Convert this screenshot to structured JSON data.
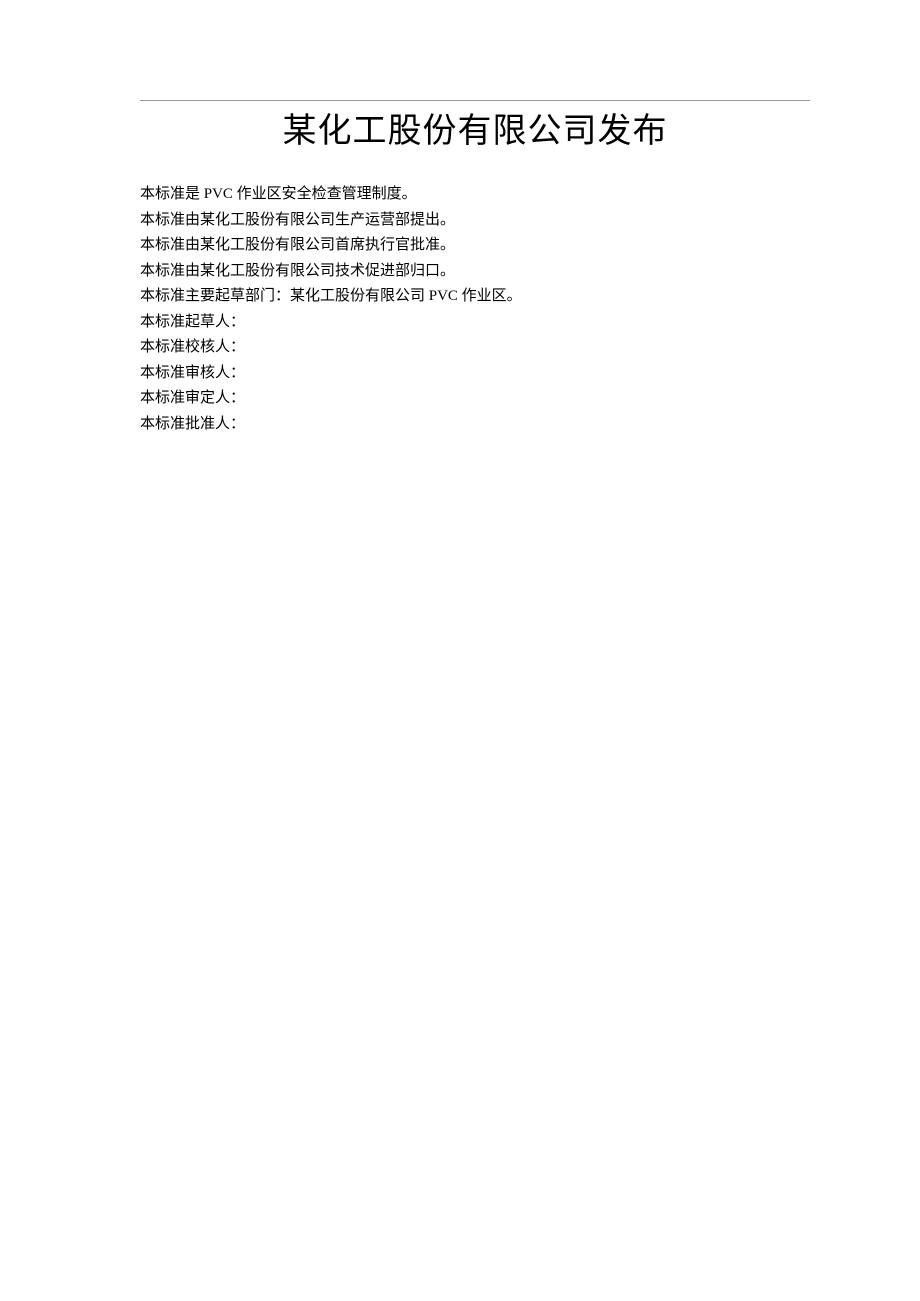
{
  "title": "某化工股份有限公司发布",
  "lines": {
    "l1": "本标准是 PVC 作业区安全检查管理制度。",
    "l2": "本标准由某化工股份有限公司生产运营部提出。",
    "l3": "本标准由某化工股份有限公司首席执行官批准。",
    "l4": "本标准由某化工股份有限公司技术促进部归口。",
    "l5": "本标准主要起草部门：某化工股份有限公司 PVC 作业区。",
    "l6": "本标准起草人：",
    "l7": "本标准校核人：",
    "l8": "本标准审核人：",
    "l9": "本标准审定人：",
    "l10": "本标准批准人："
  }
}
